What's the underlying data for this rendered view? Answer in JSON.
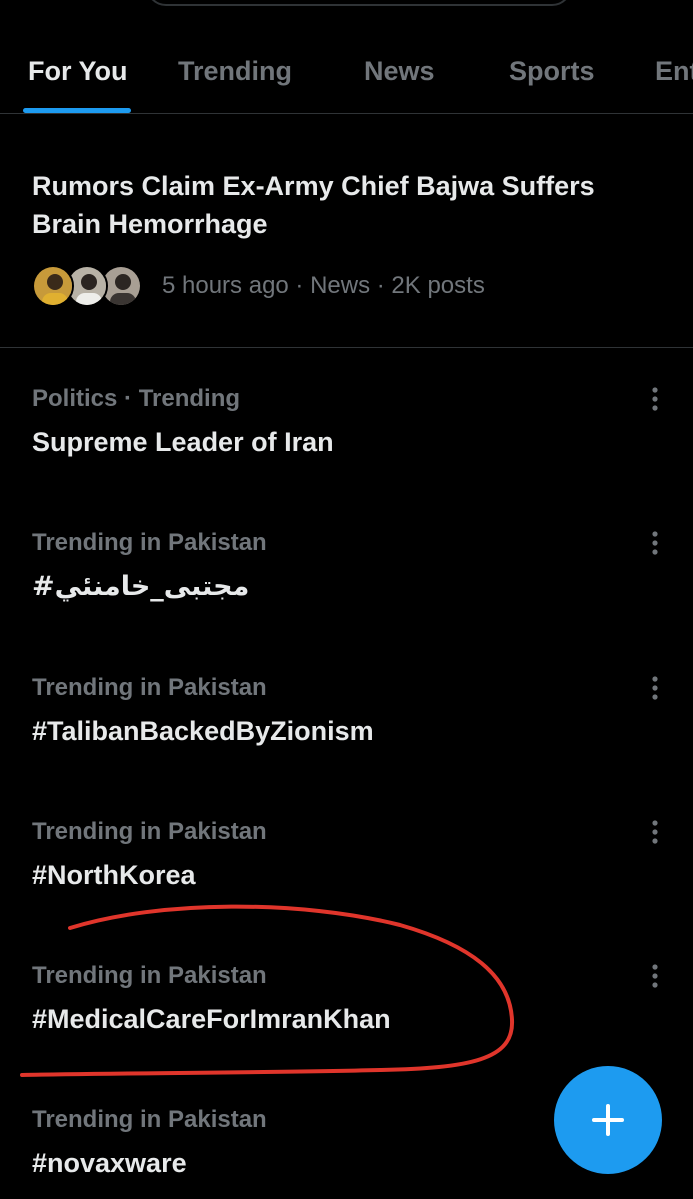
{
  "tabs": [
    {
      "label": "For You",
      "active": true
    },
    {
      "label": "Trending",
      "active": false
    },
    {
      "label": "News",
      "active": false
    },
    {
      "label": "Sports",
      "active": false
    },
    {
      "label": "Ent",
      "active": false
    }
  ],
  "news": {
    "title": "Rumors Claim Ex-Army Chief Bajwa Suffers Brain Hemorrhage",
    "meta": "5 hours ago · News · 2K posts"
  },
  "trends": [
    {
      "context": "Politics · Trending",
      "name": "Supreme Leader of Iran"
    },
    {
      "context": "Trending in Pakistan",
      "name": "#مجتبی_خامنئي"
    },
    {
      "context": "Trending in Pakistan",
      "name": "#TalibanBackedByZionism"
    },
    {
      "context": "Trending in Pakistan",
      "name": "#NorthKorea"
    },
    {
      "context": "Trending in Pakistan",
      "name": "#MedicalCareForImranKhan"
    },
    {
      "context": "Trending in Pakistan",
      "name": "#novaxware"
    }
  ],
  "colors": {
    "background": "#000000",
    "accent": "#1d9bf0",
    "annotation": "#e0352b",
    "muted_text": "#71767b"
  },
  "icons": {
    "more": "more-vertical-icon",
    "compose": "plus-icon"
  }
}
